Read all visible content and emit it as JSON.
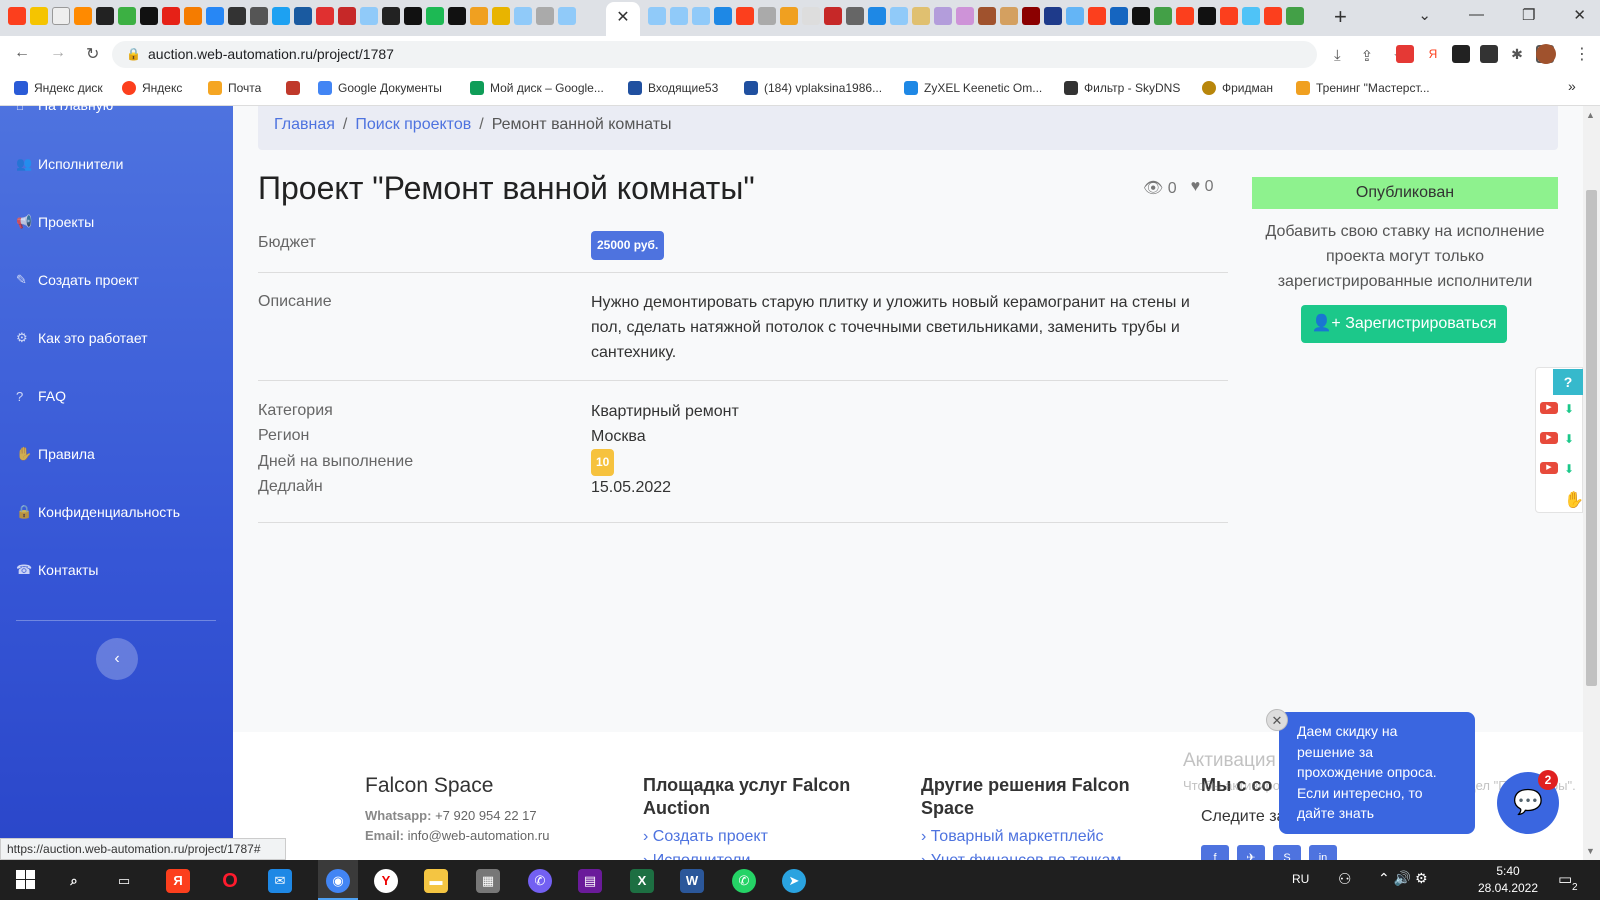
{
  "browser": {
    "url": "auction.web-automation.ru/project/1787",
    "active_tab_close": "✕",
    "new_tab": "+",
    "window_buttons": [
      "⌄",
      "—",
      "❐",
      "✕"
    ],
    "nav_buttons": [
      "←",
      "→",
      "↻"
    ],
    "toolbar_icons": [
      "⤓",
      "⇪",
      "☆"
    ],
    "menu": "⋮",
    "status_url": "https://auction.web-automation.ru/project/1787#"
  },
  "bookmarks": [
    {
      "label": "Яндекс диск",
      "color": "#2a5bd7"
    },
    {
      "label": "Яндекс",
      "color": "#fc3f1d"
    },
    {
      "label": "Почта",
      "color": "#f5a623"
    },
    {
      "label": "",
      "color": "#c0392b"
    },
    {
      "label": "Google Документы",
      "color": "#4285f4"
    },
    {
      "label": "Мой диск – Google...",
      "color": "#0f9d58"
    },
    {
      "label": "Входящие53",
      "color": "#2050a0"
    },
    {
      "label": "(184) vplaksina1986...",
      "color": "#2050a0"
    },
    {
      "label": "ZyXEL Keenetic Om...",
      "color": "#1e88e5"
    },
    {
      "label": "Фильтр - SkyDNS",
      "color": "#333333"
    },
    {
      "label": "Фридман",
      "color": "#b8860b"
    },
    {
      "label": "Тренинг \"Мастерст...",
      "color": "#f0a020"
    }
  ],
  "bookmarks_more": "»",
  "sidebar": {
    "items": [
      {
        "label": "На главную",
        "icon": "⌂"
      },
      {
        "label": "Исполнители",
        "icon": "👥"
      },
      {
        "label": "Проекты",
        "icon": "📢"
      },
      {
        "label": "Создать проект",
        "icon": "✎"
      },
      {
        "label": "Как это работает",
        "icon": "⚙"
      },
      {
        "label": "FAQ",
        "icon": "?"
      },
      {
        "label": "Правила",
        "icon": "✋"
      },
      {
        "label": "Конфиденциальность",
        "icon": "🔒"
      },
      {
        "label": "Контакты",
        "icon": "☎"
      }
    ],
    "toggle": "‹"
  },
  "breadcrumb": {
    "home": "Главная",
    "search": "Поиск проектов",
    "current": "Ремонт ванной комнаты",
    "separator": "/"
  },
  "project": {
    "title": "Проект \"Ремонт ванной комнаты\"",
    "views": "0",
    "likes": "0",
    "budget_label": "Бюджет",
    "budget_value": "25000 руб.",
    "description_label": "Описание",
    "description": "Нужно демонтировать старую плитку и уложить новый керамогранит на стены и пол, сделать натяжной потолок с точечными светильниками, заменить трубы и сантехнику.",
    "category_label": "Категория",
    "category": "Квартирный ремонт",
    "region_label": "Регион",
    "region": "Москва",
    "days_label": "Дней на выполнение",
    "days": "10",
    "deadline_label": "Дедлайн",
    "deadline": "15.05.2022"
  },
  "aside": {
    "status": "Опубликован",
    "note": "Добавить свою ставку на исполнение проекта могут только зарегистрированные исполнители",
    "register_button": "Зарегистрироваться"
  },
  "footer": {
    "brand": "Falcon Space",
    "whatsapp_label": "Whatsapp:",
    "whatsapp": "+7 920 954 22 17",
    "email_label": "Email:",
    "email": "info@web-automation.ru",
    "col2_title": "Площадка услуг Falcon Auction",
    "col2_links": [
      "Создать проект",
      "Исполнители"
    ],
    "col3_title": "Другие решения Falcon Space",
    "col3_links": [
      "Товарный маркетплейс",
      "Учет финансов по точкам"
    ],
    "col4_title": "Мы с со",
    "col4_text": "Следите за",
    "socials": [
      "f",
      "✈",
      "S",
      "in"
    ]
  },
  "watermark": {
    "title": "Активация Windows",
    "text": "Чтобы активировать Windows, перейдите в раздел \"Параметры\"."
  },
  "chat": {
    "popup": "Даем скидку на решение за прохождение опроса. Если интересно, то дайте знать",
    "close": "✕",
    "badge": "2",
    "icon": "💬"
  },
  "float_panel": {
    "help": "?"
  },
  "taskbar": {
    "lang": "RU",
    "time": "5:40",
    "date": "28.04.2022",
    "notif_count": "2"
  }
}
